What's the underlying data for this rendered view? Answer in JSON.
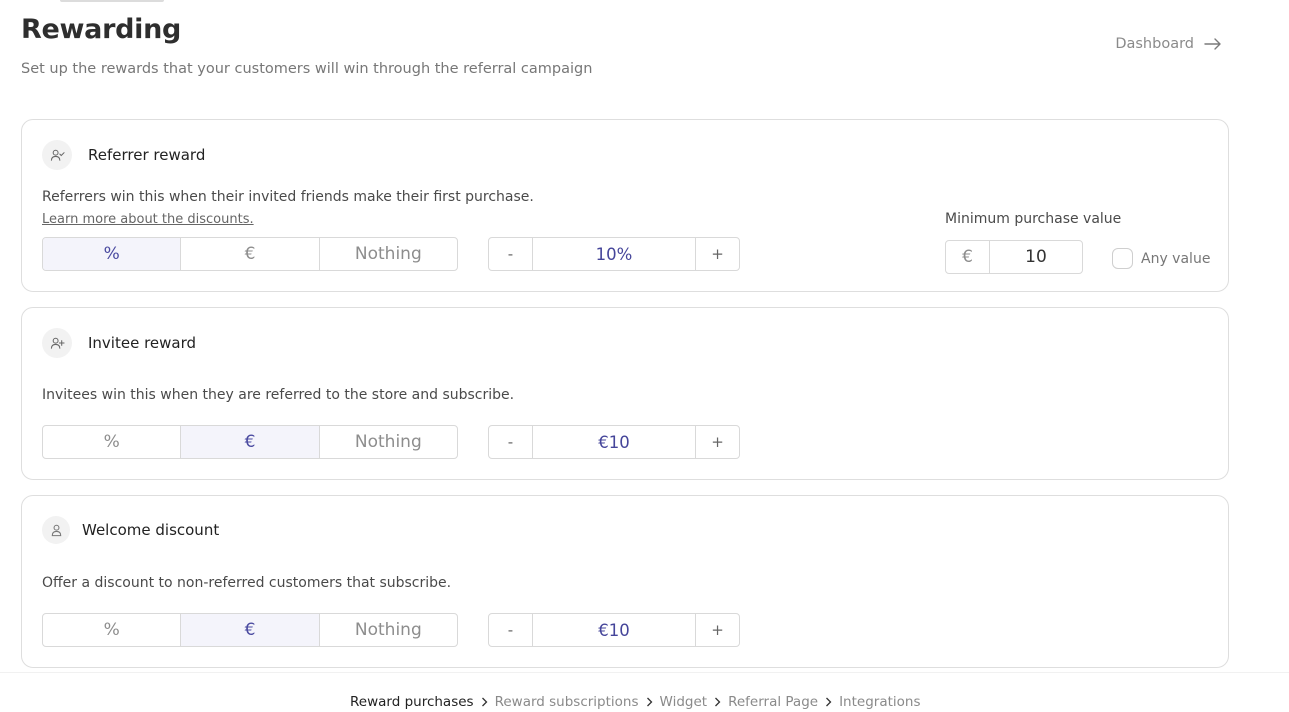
{
  "header": {
    "title": "Rewarding",
    "subtitle": "Set up the rewards that your customers will win through the referral campaign",
    "dashboard_label": "Dashboard"
  },
  "referrer": {
    "title": "Referrer reward",
    "description": "Referrers win this when their invited friends make their first purchase.",
    "learn_more": "Learn more about the discounts.",
    "options": [
      "%",
      "€",
      "Nothing"
    ],
    "selected": "%",
    "value": "10%",
    "minus": "-",
    "plus": "+",
    "min_label": "Minimum purchase value",
    "min_currency": "€",
    "min_value": "10",
    "any_value_label": "Any value"
  },
  "invitee": {
    "title": "Invitee reward",
    "description": "Invitees win this when they are referred to the store and subscribe.",
    "options": [
      "%",
      "€",
      "Nothing"
    ],
    "selected": "€",
    "value": "€10",
    "minus": "-",
    "plus": "+"
  },
  "welcome": {
    "title": "Welcome discount",
    "description": "Offer a discount to non-referred customers that subscribe.",
    "options": [
      "%",
      "€",
      "Nothing"
    ],
    "selected": "€",
    "value": "€10",
    "minus": "-",
    "plus": "+"
  },
  "breadcrumb": {
    "items": [
      "Reward purchases",
      "Reward subscriptions",
      "Widget",
      "Referral Page",
      "Integrations"
    ],
    "current_index": 0
  },
  "colors": {
    "accent": "#45459a",
    "active_bg": "#f4f4fb",
    "border": "#dedede"
  },
  "icons": {
    "dashboard": "arrow-right-icon",
    "referrer": "user-check-icon",
    "invitee": "user-plus-icon",
    "welcome": "user-icon",
    "separator": "chevron-right-icon"
  }
}
